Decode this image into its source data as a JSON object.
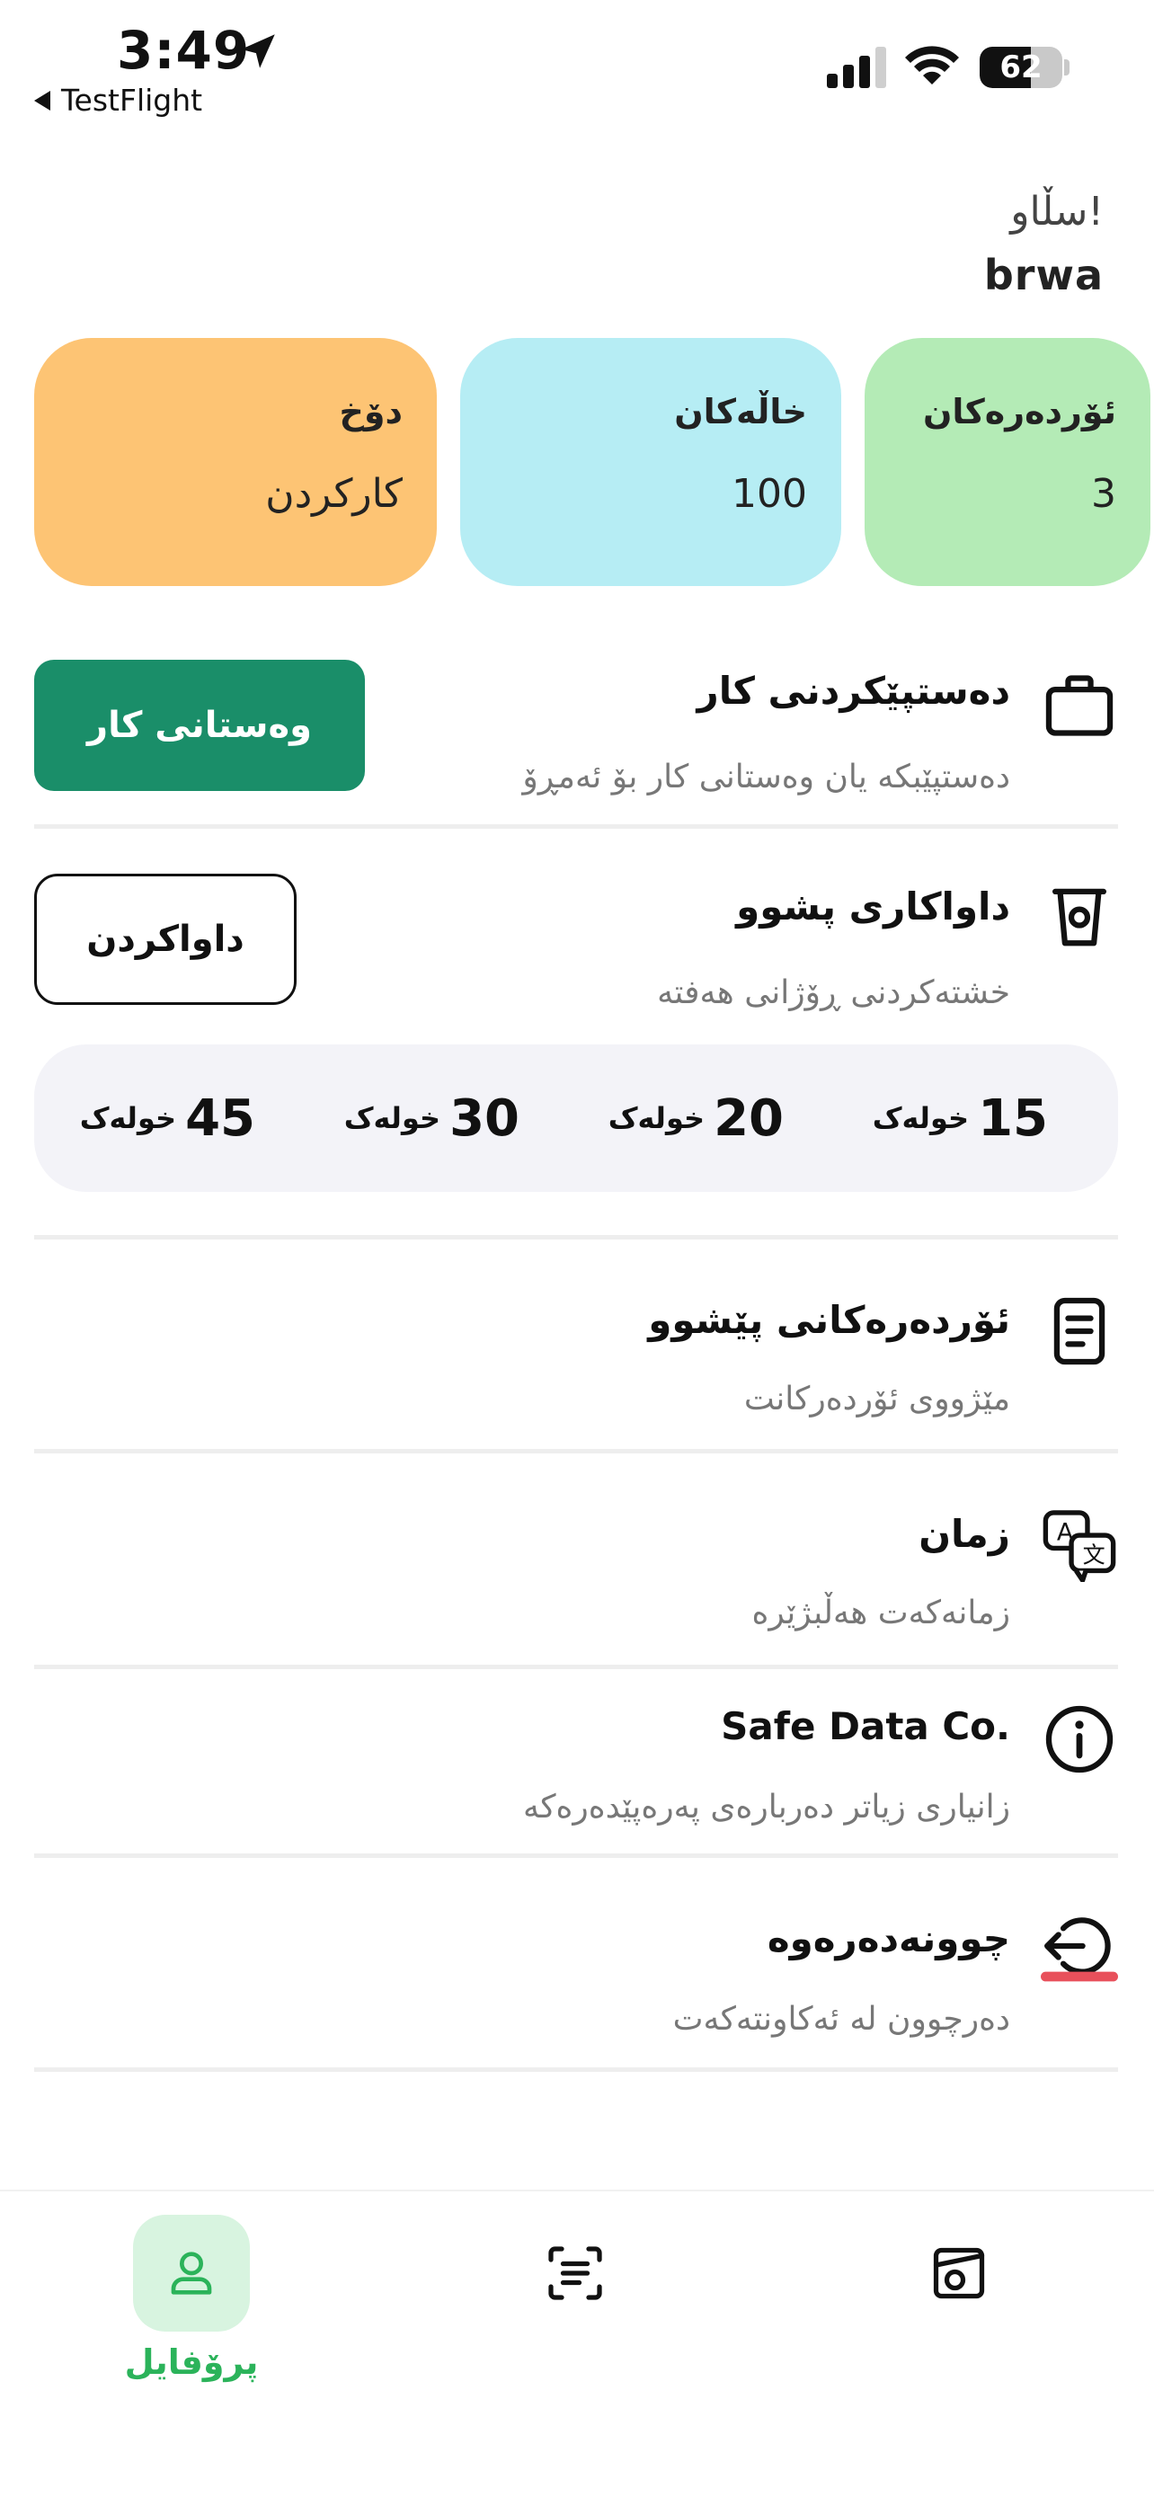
{
  "status_bar": {
    "time": "3:49",
    "back_app": "TestFlight",
    "battery": "62",
    "battery_fraction": 0.62
  },
  "greeting": {
    "hello": "سڵاو!",
    "name": "brwa"
  },
  "cards": {
    "orders": {
      "title": "ئۆردەرەکان",
      "value": "3"
    },
    "points": {
      "title": "خاڵەکان",
      "value": "100"
    },
    "status": {
      "title": "دۆخ",
      "value": "کارکردن"
    }
  },
  "work": {
    "title": "دەستپێکردنی کار",
    "subtitle": "دەستپێبکە یان وەستانی کار بۆ ئەمڕۆ",
    "button": "وەستانی کار"
  },
  "break": {
    "title": "داواکاری پشوو",
    "subtitle": "خشتەکردنی ڕۆژانی هەفتە",
    "button": "داواکردن",
    "options": [
      {
        "value": "15",
        "unit": "خولەک"
      },
      {
        "value": "20",
        "unit": "خولەک"
      },
      {
        "value": "30",
        "unit": "خولەک"
      },
      {
        "value": "45",
        "unit": "خولەک"
      }
    ]
  },
  "menu": {
    "orders_history": {
      "title": "ئۆردەرەکانی پێشوو",
      "subtitle": "مێژووی ئۆردەرکانت"
    },
    "language": {
      "title": "زمان",
      "subtitle": "زمانەکەت هەڵبژێرە"
    },
    "about": {
      "title": "Safe Data Co.",
      "subtitle": "زانیاری زیاتر دەربارەی پەرەپێدەرەکە"
    },
    "logout": {
      "title": "چوونەدەرەوە",
      "subtitle": "دەرچوون لە ئەکاونتەکەت"
    }
  },
  "bottom_nav": {
    "profile_label": "پرۆفایل"
  },
  "colors": {
    "accent_green": "#1a8e69",
    "nav_active_bg": "#d8f4e0",
    "nav_active_text": "#2bb35a",
    "card_status": "#fdc474",
    "card_points": "#b6edf4",
    "card_orders": "#b4ebb6",
    "logout_underline": "#e8505b"
  },
  "icons": {
    "work": "briefcase-icon",
    "break": "coffee-cup-icon",
    "orders_history": "document-list-icon",
    "language": "translate-icon",
    "about": "info-icon",
    "logout": "logout-icon",
    "nav_profile": "user-icon",
    "nav_scan": "scan-text-icon",
    "nav_camera": "photo-frame-icon"
  }
}
